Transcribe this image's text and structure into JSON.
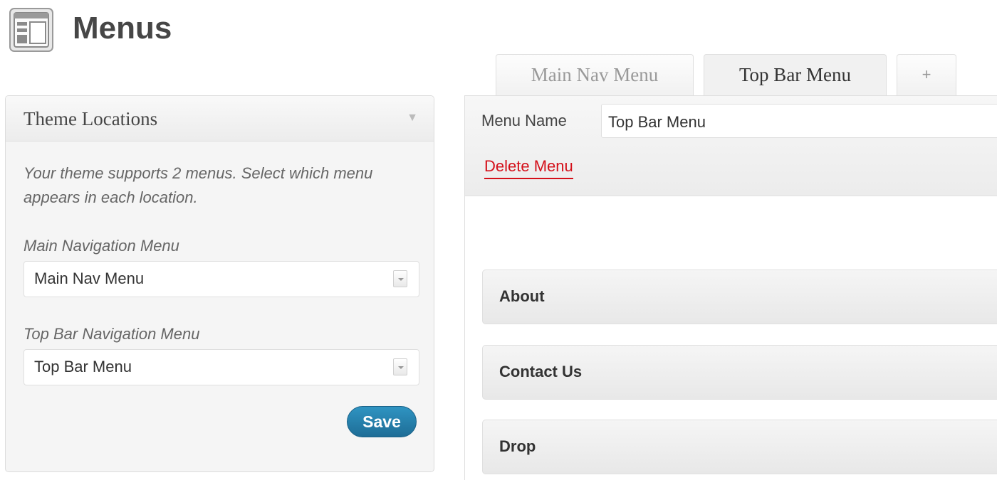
{
  "page": {
    "title": "Menus",
    "icon": "menus-layout-icon"
  },
  "theme_locations": {
    "title": "Theme Locations",
    "toggle_icon": "▼",
    "description": "Your theme supports 2 menus. Select which menu appears in each location.",
    "locations": [
      {
        "label": "Main Navigation Menu",
        "selected": "Main Nav Menu"
      },
      {
        "label": "Top Bar Navigation Menu",
        "selected": "Top Bar Menu"
      }
    ],
    "save_label": "Save"
  },
  "tabs": [
    {
      "label": "Main Nav Menu",
      "active": false
    },
    {
      "label": "Top Bar Menu",
      "active": true
    },
    {
      "label": "+",
      "active": false
    }
  ],
  "menu_editor": {
    "name_label": "Menu Name",
    "name_value": "Top Bar Menu",
    "delete_label": "Delete Menu",
    "items": [
      {
        "title": "About"
      },
      {
        "title": "Contact Us"
      },
      {
        "title": "Drop"
      }
    ]
  },
  "colors": {
    "accent_button": "#21759b",
    "delete_link": "#d4101a"
  }
}
